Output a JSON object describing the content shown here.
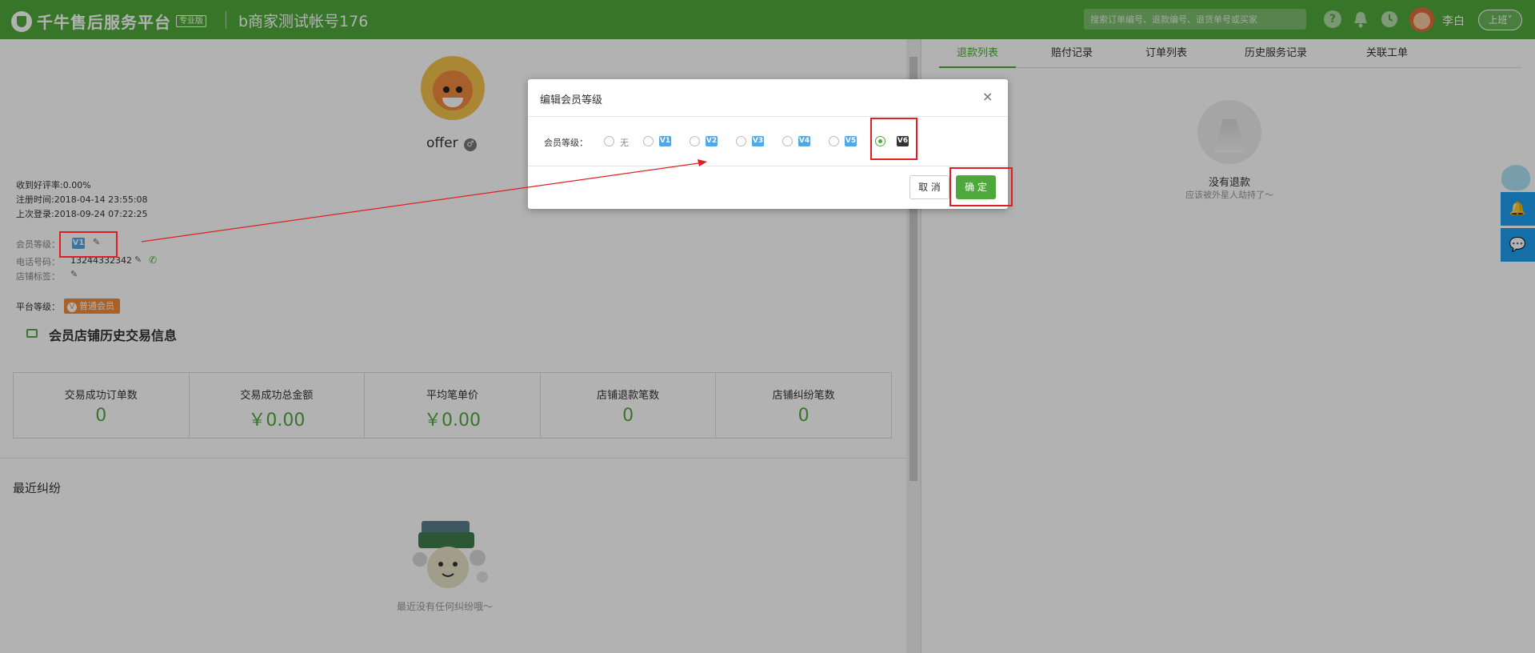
{
  "header": {
    "logo_text": "千牛售后服务平台",
    "edition_badge": "专业版",
    "account_name": "b商家测试帐号176",
    "search_placeholder": "搜索订单编号、退款编号、退货单号或买家",
    "help_icon_glyph": "?",
    "user_name": "李白",
    "shift_label": "上班",
    "shift_arrow": "˅",
    "accent_color": "#4fa83c"
  },
  "profile": {
    "nickname": "offer",
    "gender_glyph": "♂",
    "good_rate": "收到好评率:0.00%",
    "register_time": "注册时间:2018-04-14 23:55:08",
    "last_login": "上次登录:2018-09-24 07:22:25",
    "member_level_label": "会员等级：",
    "member_level_icon": "V1",
    "phone_label": "电话号码：",
    "phone_value": "13244332342",
    "store_tag_label": "店铺标签：",
    "platform_level_label": "平台等级：",
    "platform_level_badge_glyph": "V",
    "platform_level_badge": "普通会员",
    "edit_glyph": "✎",
    "phone_glyph": "✆"
  },
  "history": {
    "title": "会员店铺历史交易信息",
    "stats": [
      {
        "label": "交易成功订单数",
        "value": "0"
      },
      {
        "label": "交易成功总金额",
        "value": "￥0.00"
      },
      {
        "label": "平均笔单价",
        "value": "￥0.00"
      },
      {
        "label": "店铺退款笔数",
        "value": "0"
      },
      {
        "label": "店铺纠纷笔数",
        "value": "0"
      }
    ]
  },
  "recent": {
    "title": "最近纠纷",
    "empty_text": "最近没有任何纠纷哦～"
  },
  "right_panel": {
    "tabs": [
      "退款列表",
      "赔付记录",
      "订单列表",
      "历史服务记录",
      "关联工单"
    ],
    "active_tab": 0,
    "empty_title": "没有退款",
    "empty_sub": "应该被外星人劫持了～"
  },
  "side_buttons": {
    "bell_glyph": "🔔",
    "chat_glyph": "💬"
  },
  "modal": {
    "title": "编辑会员等级",
    "close_glyph": "×",
    "level_label": "会员等级：",
    "options": [
      {
        "text": "无",
        "checked": false
      },
      {
        "icon": "V1",
        "checked": false
      },
      {
        "icon": "V2",
        "checked": false
      },
      {
        "icon": "V3",
        "checked": false
      },
      {
        "icon": "V4",
        "checked": false
      },
      {
        "icon": "V5",
        "checked": false
      },
      {
        "icon": "V6",
        "checked": true
      }
    ],
    "cancel_label": "取 消",
    "confirm_label": "确 定"
  },
  "annotation_color": "#e02020"
}
